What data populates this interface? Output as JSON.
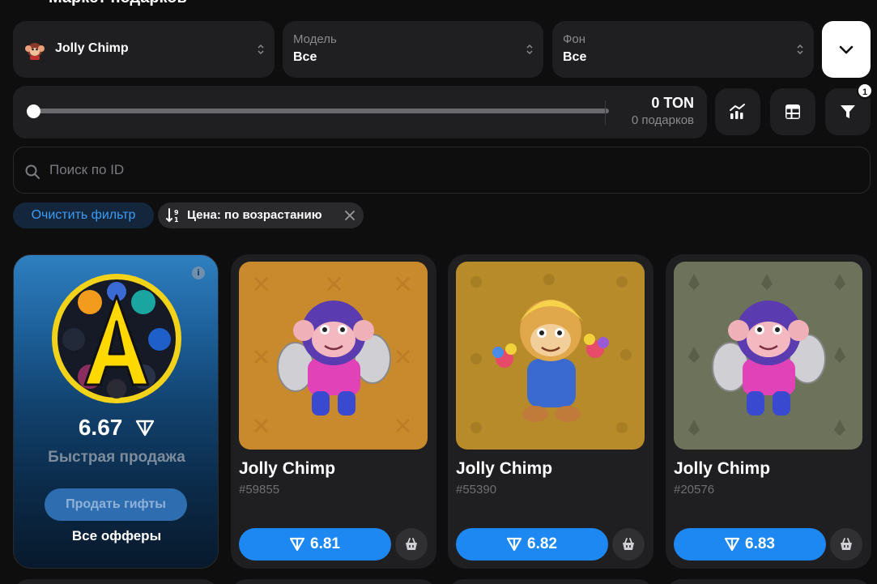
{
  "header": {
    "title": "Маркет подарков"
  },
  "filters": {
    "collection": {
      "value": "Jolly Chimp",
      "icon": "monkey-avatar"
    },
    "model": {
      "label": "Модель",
      "value": "Все"
    },
    "background": {
      "label": "Фон",
      "value": "Все"
    }
  },
  "price_range": {
    "amount": "0 TON",
    "gifts": "0 подарков",
    "slider_fraction": 0.0
  },
  "toolbar": {
    "filter_badge": "1"
  },
  "search": {
    "placeholder": "Поиск по ID"
  },
  "chips": {
    "clear": "Очистить фильтр",
    "sort": "Цена: по возрастанию"
  },
  "promo": {
    "price": "6.67",
    "subtitle": "Быстрая продажа",
    "sell_button": "Продать гифты",
    "all_offers": "Все офферы",
    "info": "i"
  },
  "items": [
    {
      "name": "Jolly Chimp",
      "number": "#59855",
      "price": "6.81",
      "bg": "#c98a2e",
      "variant": "purple-cymbals"
    },
    {
      "name": "Jolly Chimp",
      "number": "#55390",
      "price": "6.82",
      "bg": "#b78a2a",
      "variant": "blonde-flowers"
    },
    {
      "name": "Jolly Chimp",
      "number": "#20576",
      "price": "6.83",
      "bg": "#6d725a",
      "variant": "purple-cymbals"
    }
  ],
  "colors": {
    "accent": "#1e88f2",
    "card": "#1f1f21",
    "page": "#0e0e0f"
  }
}
